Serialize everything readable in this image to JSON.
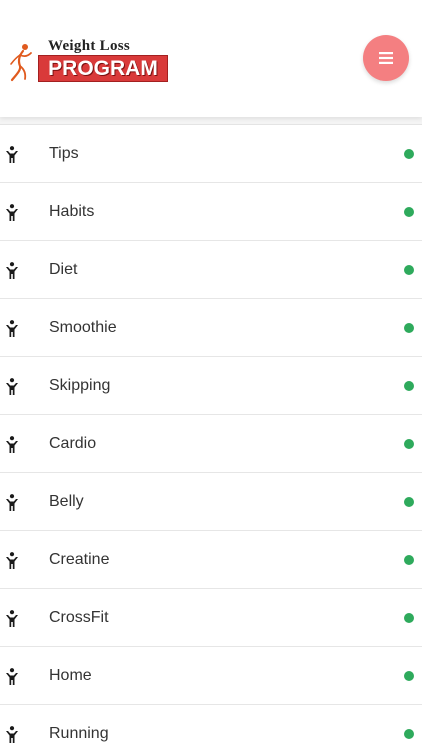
{
  "header": {
    "logo": {
      "line1": "Weight Loss",
      "line2": "PROGRAM"
    },
    "menu_icon": "hamburger-icon"
  },
  "colors": {
    "menu_button": "#f47f81",
    "logo_red": "#d93a3a",
    "status_dot": "#2eaa5c",
    "text": "#333333"
  },
  "list": {
    "item_icon": "person-icon",
    "items": [
      {
        "label": "Tips"
      },
      {
        "label": "Habits"
      },
      {
        "label": "Diet"
      },
      {
        "label": "Smoothie"
      },
      {
        "label": "Skipping"
      },
      {
        "label": "Cardio"
      },
      {
        "label": "Belly"
      },
      {
        "label": "Creatine"
      },
      {
        "label": "CrossFit"
      },
      {
        "label": "Home"
      },
      {
        "label": "Running"
      }
    ]
  }
}
